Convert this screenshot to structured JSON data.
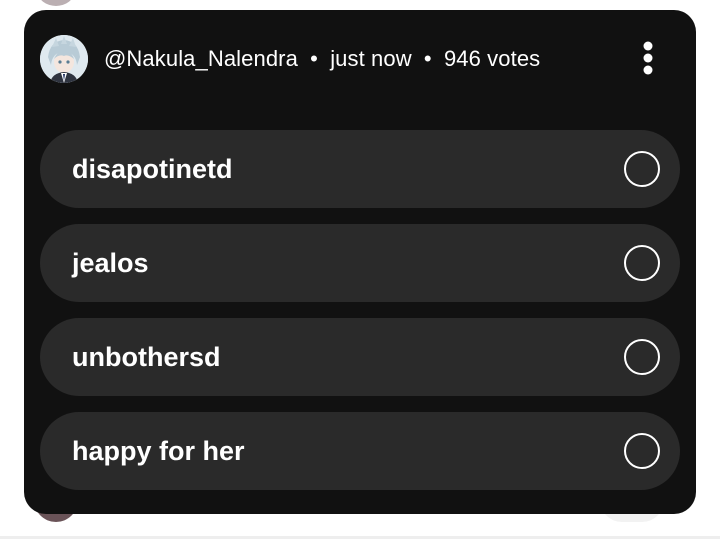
{
  "poll": {
    "author": "@Nakula_Nalendra",
    "separator": "•",
    "time": "just now",
    "votes": "946 votes",
    "options": [
      {
        "label": "disapotinetd",
        "selected": false
      },
      {
        "label": "jealos",
        "selected": false
      },
      {
        "label": "unbothersd",
        "selected": false
      },
      {
        "label": "happy for her",
        "selected": false
      }
    ]
  },
  "icons": {
    "more": "more-vertical-icon",
    "avatar": "anime-avatar"
  },
  "colors": {
    "card_background": "#111111",
    "option_background": "#2a2a2a",
    "text": "#ffffff"
  }
}
